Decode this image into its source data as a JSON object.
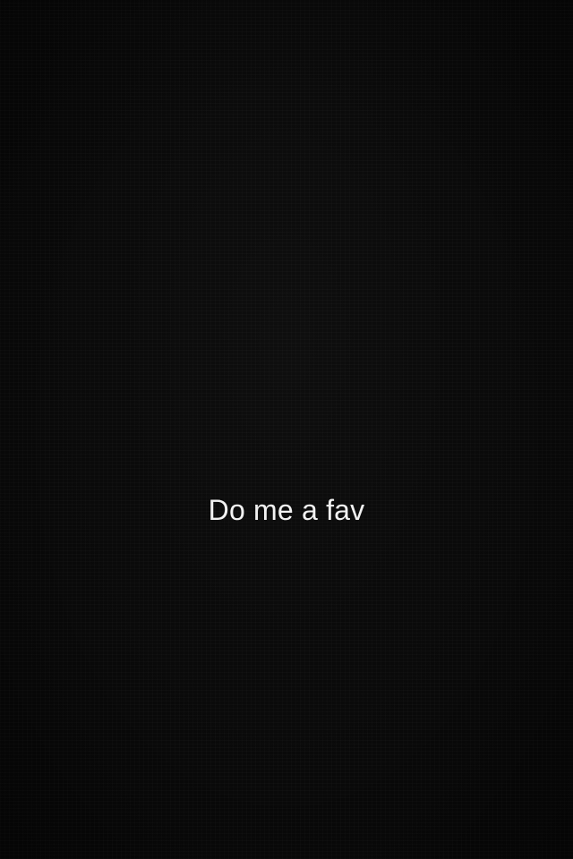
{
  "caption": {
    "text": "Do me a fav"
  },
  "colors": {
    "background": "#080808",
    "caption_text": "#f2f2f2"
  }
}
